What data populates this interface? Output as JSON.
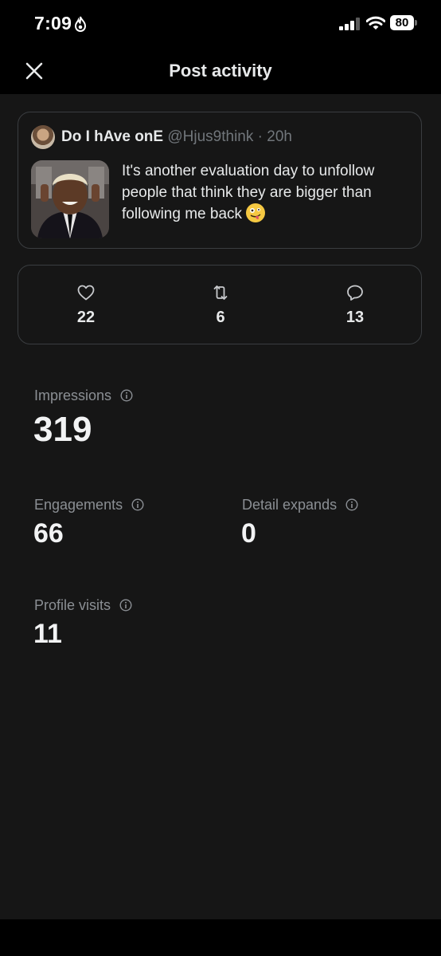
{
  "status_bar": {
    "time": "7:09",
    "battery": "80"
  },
  "nav": {
    "title": "Post activity"
  },
  "post": {
    "author_name": "Do I hAve onE",
    "handle": "@Hjus9think",
    "separator": "·",
    "age": "20h",
    "text": "It's another evaluation day to unfollow people that think they are bigger than following me back"
  },
  "engagement_stats": {
    "likes": "22",
    "reposts": "6",
    "replies": "13"
  },
  "metrics": {
    "impressions": {
      "label": "Impressions",
      "value": "319"
    },
    "engagements": {
      "label": "Engagements",
      "value": "66"
    },
    "detail_expands": {
      "label": "Detail expands",
      "value": "0"
    },
    "profile_visits": {
      "label": "Profile visits",
      "value": "11"
    }
  },
  "colors": {
    "background": "#161616",
    "bar": "#000000",
    "text_primary": "#e7e9ea",
    "text_secondary": "#71767b",
    "border": "#3a3d40"
  }
}
